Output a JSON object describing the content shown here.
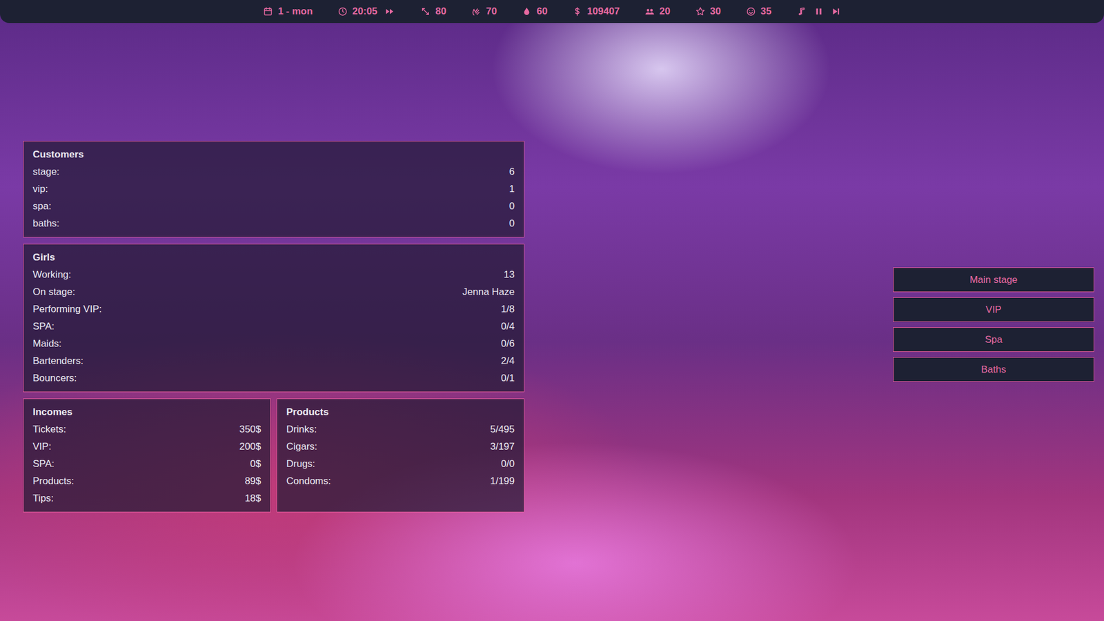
{
  "top_bar": {
    "stats": [
      {
        "icon": "calendar",
        "value": "1 - mon"
      },
      {
        "icon": "clock",
        "value": "20:05"
      },
      {
        "icon": "arrows",
        "value": "80"
      },
      {
        "icon": "hands",
        "value": "70"
      },
      {
        "icon": "drop",
        "value": "60"
      },
      {
        "icon": "dollar",
        "value": "109407"
      },
      {
        "icon": "people",
        "value": "20"
      },
      {
        "icon": "star",
        "value": "30"
      },
      {
        "icon": "smile",
        "value": "35"
      }
    ]
  },
  "customers": {
    "title": "Customers",
    "rows": [
      {
        "label": "stage:",
        "value": "6"
      },
      {
        "label": "vip:",
        "value": "1"
      },
      {
        "label": "spa:",
        "value": "0"
      },
      {
        "label": "baths:",
        "value": "0"
      }
    ]
  },
  "girls": {
    "title": "Girls",
    "rows": [
      {
        "label": "Working:",
        "value": "13"
      },
      {
        "label": "On stage:",
        "value": "Jenna Haze"
      },
      {
        "label": "Performing VIP:",
        "value": "1/8"
      },
      {
        "label": "SPA:",
        "value": "0/4"
      },
      {
        "label": "Maids:",
        "value": "0/6"
      },
      {
        "label": "Bartenders:",
        "value": "2/4"
      },
      {
        "label": "Bouncers:",
        "value": "0/1"
      }
    ]
  },
  "incomes": {
    "title": "Incomes",
    "rows": [
      {
        "label": "Tickets:",
        "value": "350$"
      },
      {
        "label": "VIP:",
        "value": "200$"
      },
      {
        "label": "SPA:",
        "value": "0$"
      },
      {
        "label": "Products:",
        "value": "89$"
      },
      {
        "label": "Tips:",
        "value": "18$"
      }
    ]
  },
  "products": {
    "title": "Products",
    "rows": [
      {
        "label": "Drinks:",
        "value": "5/495"
      },
      {
        "label": "Cigars:",
        "value": "3/197"
      },
      {
        "label": "Drugs:",
        "value": "0/0"
      },
      {
        "label": "Condoms:",
        "value": "1/199"
      }
    ]
  },
  "nav_buttons": [
    "Main stage",
    "VIP",
    "Spa",
    "Baths"
  ]
}
